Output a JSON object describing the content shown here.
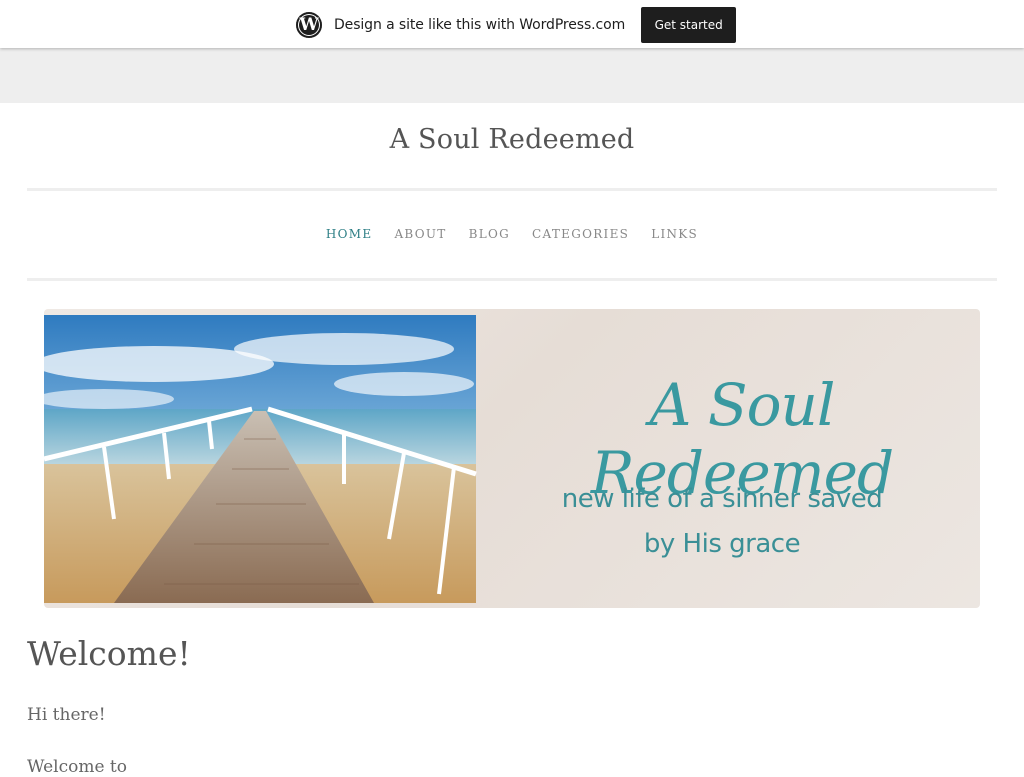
{
  "promo": {
    "logo_glyph": "W",
    "message": "Design a site like this with WordPress.com",
    "cta_label": "Get started"
  },
  "site": {
    "title": "A Soul Redeemed"
  },
  "nav": {
    "items": [
      {
        "label": "HOME",
        "active": true
      },
      {
        "label": "ABOUT",
        "active": false
      },
      {
        "label": "BLOG",
        "active": false
      },
      {
        "label": "CATEGORIES",
        "active": false
      },
      {
        "label": "LINKS",
        "active": false
      }
    ]
  },
  "header_image": {
    "title": "A Soul Redeemed",
    "subtitle_line1": "new life of a sinner saved",
    "subtitle_line2": "by His grace"
  },
  "post": {
    "title": "Welcome!",
    "paragraph1": "Hi there!",
    "paragraph2": "Welcome to"
  },
  "colors": {
    "accent": "#2e7f86",
    "title_teal": "#3a99a0"
  }
}
